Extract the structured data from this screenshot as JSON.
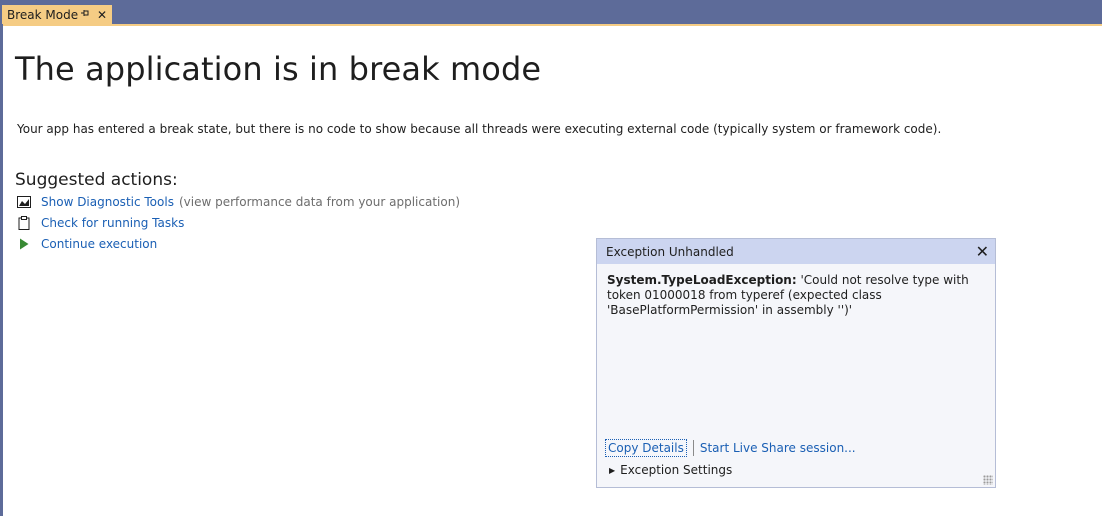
{
  "tab": {
    "label": "Break Mode",
    "pin_icon": "pin-icon",
    "close_glyph": "✕"
  },
  "page": {
    "title": "The application is in break mode",
    "description": "Your app has entered a break state, but there is no code to show because all threads were executing external code (typically system or framework code).",
    "suggested_heading": "Suggested actions:",
    "actions": [
      {
        "icon": "chart-icon",
        "label": "Show Diagnostic Tools",
        "note": "(view performance data from your application)"
      },
      {
        "icon": "clipboard-icon",
        "label": "Check for running Tasks",
        "note": ""
      },
      {
        "icon": "play-icon",
        "label": "Continue execution",
        "note": ""
      }
    ]
  },
  "exception": {
    "title": "Exception Unhandled",
    "close_glyph": "✕",
    "type": "System.TypeLoadException:",
    "message": " 'Could not resolve type with token 01000018 from typeref (expected class 'BasePlatformPermission' in assembly '')'",
    "copy_details": "Copy Details",
    "live_share": "Start Live Share session...",
    "settings": "Exception Settings"
  },
  "colors": {
    "tab_strip": "#5d6b99",
    "tab_active": "#f5cc84",
    "link": "#1a5fb4",
    "popup_header": "#ccd5f0"
  }
}
